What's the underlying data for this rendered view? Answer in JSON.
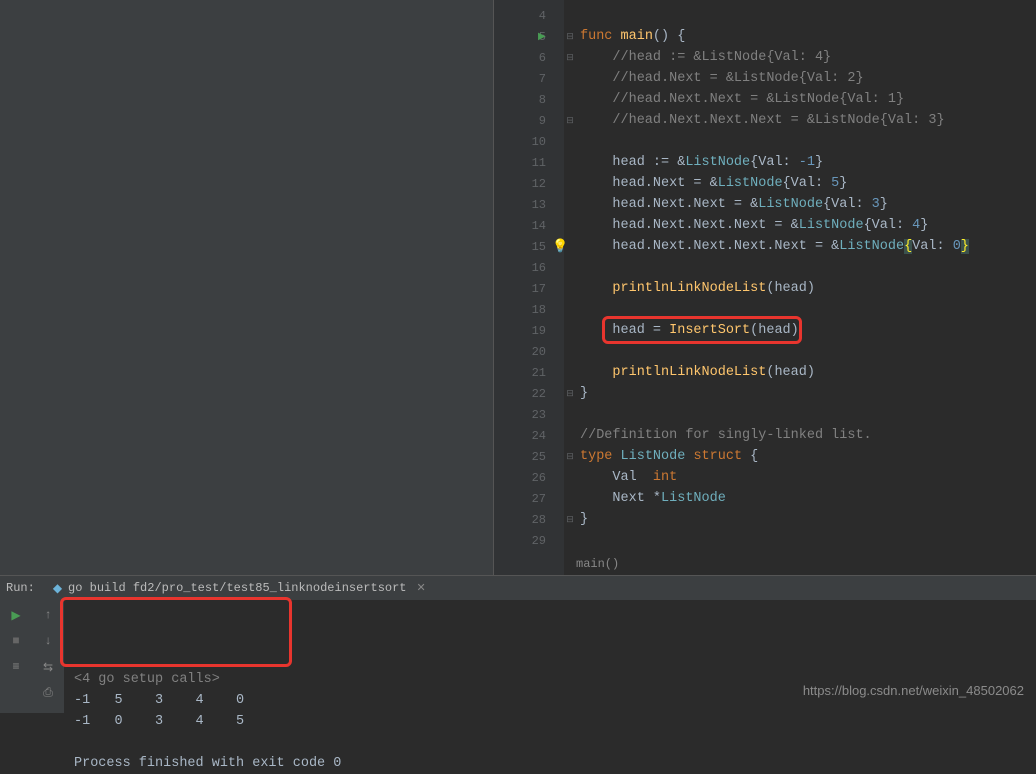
{
  "editor": {
    "lines": [
      {
        "n": 4,
        "play": false,
        "fold": "",
        "tokens": []
      },
      {
        "n": 5,
        "play": true,
        "fold": "⊟",
        "tokens": [
          {
            "t": "func ",
            "c": "kw"
          },
          {
            "t": "main",
            "c": "fn"
          },
          {
            "t": "() {",
            "c": "br"
          }
        ]
      },
      {
        "n": 6,
        "play": false,
        "fold": "⊟",
        "tokens": [
          {
            "t": "    ",
            "c": ""
          },
          {
            "t": "//head := &ListNode{Val: 4}",
            "c": "cm"
          }
        ]
      },
      {
        "n": 7,
        "play": false,
        "fold": "",
        "tokens": [
          {
            "t": "    ",
            "c": ""
          },
          {
            "t": "//head.Next = &ListNode{Val: 2}",
            "c": "cm"
          }
        ]
      },
      {
        "n": 8,
        "play": false,
        "fold": "",
        "tokens": [
          {
            "t": "    ",
            "c": ""
          },
          {
            "t": "//head.Next.Next = &ListNode{Val: 1}",
            "c": "cm"
          }
        ]
      },
      {
        "n": 9,
        "play": false,
        "fold": "⊟",
        "tokens": [
          {
            "t": "    ",
            "c": ""
          },
          {
            "t": "//head.Next.Next.Next = &ListNode{Val: 3}",
            "c": "cm"
          }
        ]
      },
      {
        "n": 10,
        "play": false,
        "fold": "",
        "tokens": []
      },
      {
        "n": 11,
        "play": false,
        "fold": "",
        "tokens": [
          {
            "t": "    head := &",
            "c": "op"
          },
          {
            "t": "ListNode",
            "c": "ty"
          },
          {
            "t": "{Val: ",
            "c": "op"
          },
          {
            "t": "-1",
            "c": "num"
          },
          {
            "t": "}",
            "c": "br"
          }
        ]
      },
      {
        "n": 12,
        "play": false,
        "fold": "",
        "tokens": [
          {
            "t": "    head.Next = &",
            "c": "op"
          },
          {
            "t": "ListNode",
            "c": "ty"
          },
          {
            "t": "{Val: ",
            "c": "op"
          },
          {
            "t": "5",
            "c": "num"
          },
          {
            "t": "}",
            "c": "br"
          }
        ]
      },
      {
        "n": 13,
        "play": false,
        "fold": "",
        "tokens": [
          {
            "t": "    head.Next.Next = &",
            "c": "op"
          },
          {
            "t": "ListNode",
            "c": "ty"
          },
          {
            "t": "{Val: ",
            "c": "op"
          },
          {
            "t": "3",
            "c": "num"
          },
          {
            "t": "}",
            "c": "br"
          }
        ]
      },
      {
        "n": 14,
        "play": false,
        "fold": "",
        "tokens": [
          {
            "t": "    head.Next.Next.Next = &",
            "c": "op"
          },
          {
            "t": "ListNode",
            "c": "ty"
          },
          {
            "t": "{Val: ",
            "c": "op"
          },
          {
            "t": "4",
            "c": "num"
          },
          {
            "t": "}",
            "c": "br"
          }
        ]
      },
      {
        "n": 15,
        "play": false,
        "fold": "",
        "bulb": true,
        "tokens": [
          {
            "t": "    head.Next.Next.Next.Next = &",
            "c": "op"
          },
          {
            "t": "ListNode",
            "c": "ty"
          },
          {
            "t": "{",
            "c": "hl-br"
          },
          {
            "t": "Val: ",
            "c": "op"
          },
          {
            "t": "0",
            "c": "num"
          },
          {
            "t": "}",
            "c": "hl-br"
          }
        ]
      },
      {
        "n": 16,
        "play": false,
        "fold": "",
        "tokens": []
      },
      {
        "n": 17,
        "play": false,
        "fold": "",
        "tokens": [
          {
            "t": "    ",
            "c": ""
          },
          {
            "t": "printlnLinkNodeList",
            "c": "fn"
          },
          {
            "t": "(head)",
            "c": "op"
          }
        ]
      },
      {
        "n": 18,
        "play": false,
        "fold": "",
        "tokens": []
      },
      {
        "n": 19,
        "play": false,
        "fold": "",
        "tokens": [
          {
            "t": "    head = ",
            "c": "op"
          },
          {
            "t": "InsertSort",
            "c": "fn"
          },
          {
            "t": "(head)",
            "c": "op"
          }
        ]
      },
      {
        "n": 20,
        "play": false,
        "fold": "",
        "tokens": []
      },
      {
        "n": 21,
        "play": false,
        "fold": "",
        "tokens": [
          {
            "t": "    ",
            "c": ""
          },
          {
            "t": "printlnLinkNodeList",
            "c": "fn"
          },
          {
            "t": "(head)",
            "c": "op"
          }
        ]
      },
      {
        "n": 22,
        "play": false,
        "fold": "⊟",
        "tokens": [
          {
            "t": "}",
            "c": "br"
          }
        ]
      },
      {
        "n": 23,
        "play": false,
        "fold": "",
        "tokens": []
      },
      {
        "n": 24,
        "play": false,
        "fold": "",
        "tokens": [
          {
            "t": "//Definition for singly-linked list.",
            "c": "cm"
          }
        ]
      },
      {
        "n": 25,
        "play": false,
        "fold": "⊟",
        "tokens": [
          {
            "t": "type ",
            "c": "kw"
          },
          {
            "t": "ListNode ",
            "c": "ty"
          },
          {
            "t": "struct ",
            "c": "kw"
          },
          {
            "t": "{",
            "c": "br"
          }
        ]
      },
      {
        "n": 26,
        "play": false,
        "fold": "",
        "tokens": [
          {
            "t": "    Val  ",
            "c": "op"
          },
          {
            "t": "int",
            "c": "kw"
          }
        ]
      },
      {
        "n": 27,
        "play": false,
        "fold": "",
        "tokens": [
          {
            "t": "    Next *",
            "c": "op"
          },
          {
            "t": "ListNode",
            "c": "ty"
          }
        ]
      },
      {
        "n": 28,
        "play": false,
        "fold": "⊟",
        "tokens": [
          {
            "t": "}",
            "c": "br"
          }
        ]
      },
      {
        "n": 29,
        "play": false,
        "fold": "",
        "tokens": []
      }
    ],
    "breadcrumb": "main()"
  },
  "run": {
    "label": "Run:",
    "tab": "go build fd2/pro_test/test85_linknodeinsertsort",
    "output": [
      "<4 go setup calls>",
      "-1   5    3    4    0",
      "-1   0    3    4    5",
      "",
      "Process finished with exit code 0"
    ]
  },
  "watermark": "https://blog.csdn.net/weixin_48502062"
}
